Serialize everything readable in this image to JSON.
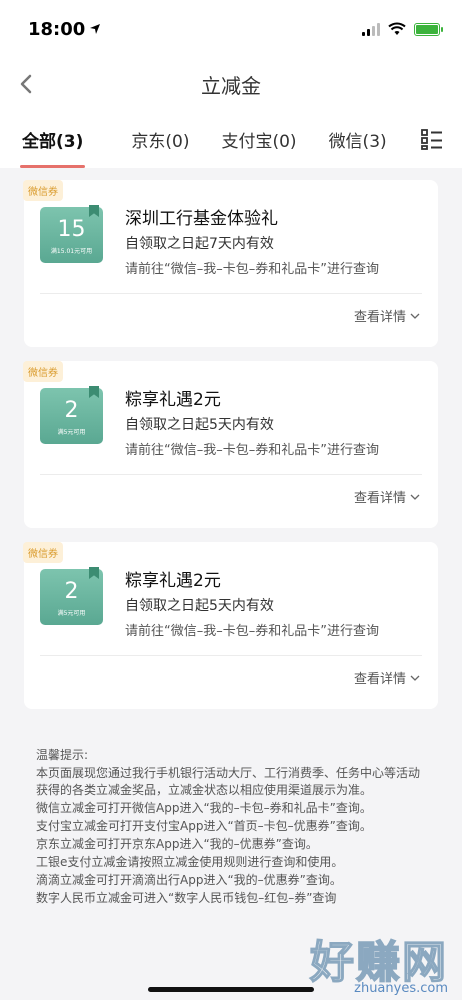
{
  "status_bar": {
    "time": "18:00"
  },
  "nav": {
    "title": "立减金"
  },
  "tabs": [
    {
      "label": "全部(3)"
    },
    {
      "label": "京东(0)"
    },
    {
      "label": "支付宝(0)"
    },
    {
      "label": "微信(3)"
    }
  ],
  "cards": [
    {
      "tag": "微信券",
      "amount": "15",
      "condition": "满15.01元可用",
      "title": "深圳工行基金体验礼",
      "validity": "自领取之日起7天内有效",
      "hint": "请前往“微信–我–卡包–券和礼品卡”进行查询",
      "detail": "查看详情"
    },
    {
      "tag": "微信券",
      "amount": "2",
      "condition": "满5元可用",
      "title": "粽享礼遇2元",
      "validity": "自领取之日起5天内有效",
      "hint": "请前往“微信–我–卡包–券和礼品卡”进行查询",
      "detail": "查看详情"
    },
    {
      "tag": "微信券",
      "amount": "2",
      "condition": "满5元可用",
      "title": "粽享礼遇2元",
      "validity": "自领取之日起5天内有效",
      "hint": "请前往“微信–我–卡包–券和礼品卡”进行查询",
      "detail": "查看详情"
    }
  ],
  "notice": {
    "title": "温馨提示:",
    "lines": [
      "本页面展现您通过我行手机银行活动大厅、工行消费季、任务中心等活动获得的各类立减金奖品，立减金状态以相应使用渠道展示为准。",
      "微信立减金可打开微信App进入“我的–卡包–券和礼品卡”查询。",
      "支付宝立减金可打开支付宝App进入“首页–卡包–优惠券”查询。",
      "京东立减金可打开京东App进入“我的–优惠券”查询。",
      "工银e支付立减金请按照立减金使用规则进行查询和使用。",
      "滴滴立减金可打开滴滴出行App进入“我的–优惠券”查询。",
      "数字人民币立减金可进入“数字人民币钱包–红包–券”查询"
    ]
  },
  "watermark": {
    "main": "好赚网",
    "url": "zhuanyes.com"
  }
}
